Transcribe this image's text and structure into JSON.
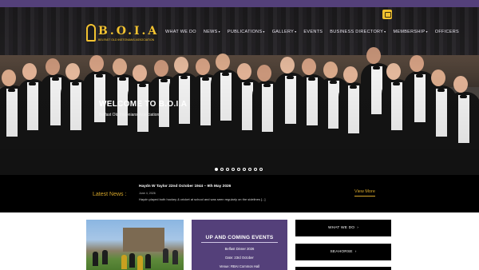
{
  "brand": {
    "name": "B.O.I.A",
    "tagline": "BELFAST OLD INSTONIANS ASSOCIATION"
  },
  "nav": [
    {
      "label": "WHAT WE DO",
      "chevron": false
    },
    {
      "label": "NEWS",
      "chevron": true
    },
    {
      "label": "PUBLICATIONS",
      "chevron": true
    },
    {
      "label": "GALLERY",
      "chevron": true
    },
    {
      "label": "EVENTS",
      "chevron": false
    },
    {
      "label": "BUSINESS DIRECTORY",
      "chevron": true
    },
    {
      "label": "MEMBERSHIP",
      "chevron": true
    },
    {
      "label": "OFFICERS",
      "chevron": false
    }
  ],
  "hero": {
    "title": "WELCOME TO B.O.I.A",
    "subtitle": "Belfast Old Instonians Association",
    "slide_count": 9,
    "active_slide": 1
  },
  "news": {
    "label": "Latest News :",
    "title": "Haydn W Taylor 22nd October 1944 – 9th May 2026",
    "date": "June 4, 2026",
    "excerpt": "Haydn played both hockey & cricket at school and was seen regularly on the sidelines [...]",
    "more_label": "View More"
  },
  "events": {
    "heading": "UP AND COMING EVENTS",
    "event_name": "Belfast Dinner 2026",
    "date_line": "Date: 23rd October",
    "venue_line": "Venue: RBAI Common Hall"
  },
  "buttons": [
    {
      "label": "WHAT WE DO",
      "arrow": "›"
    },
    {
      "label": "SEAHORSE",
      "arrow": "›"
    }
  ],
  "colors": {
    "purple": "#54407a",
    "gold": "#d4a52a",
    "black": "#000000"
  }
}
